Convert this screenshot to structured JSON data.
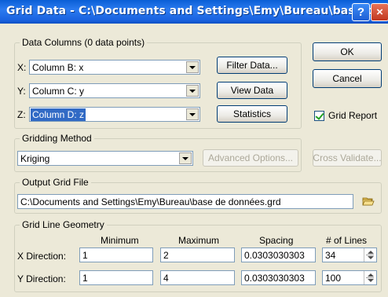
{
  "window": {
    "title": "Grid Data - C:\\Documents and Settings\\Emy\\Bureau\\base de...",
    "help_label": "?",
    "close_label": "×"
  },
  "data_columns": {
    "legend": "Data Columns   (0 data points)",
    "x": {
      "label": "X:",
      "value": "Column B:  x"
    },
    "y": {
      "label": "Y:",
      "value": "Column C:  y"
    },
    "z": {
      "label": "Z:",
      "value": "Column D:  z"
    }
  },
  "buttons": {
    "filter": "Filter Data...",
    "view": "View Data",
    "statistics": "Statistics",
    "ok": "OK",
    "cancel": "Cancel",
    "advanced": "Advanced Options...",
    "cross_validate": "Cross Validate..."
  },
  "grid_report": {
    "label": "Grid Report",
    "checked": true
  },
  "gridding_method": {
    "legend": "Gridding Method",
    "value": "Kriging"
  },
  "output_grid_file": {
    "legend": "Output Grid File",
    "path": "C:\\Documents and Settings\\Emy\\Bureau\\base de données.grd",
    "browse_icon": "open-folder-icon"
  },
  "geometry": {
    "legend": "Grid Line Geometry",
    "headers": {
      "minimum": "Minimum",
      "maximum": "Maximum",
      "spacing": "Spacing",
      "lines": "# of Lines"
    },
    "rows": [
      {
        "label": "X Direction:",
        "minimum": "1",
        "maximum": "2",
        "spacing": "0.0303030303",
        "lines": "34"
      },
      {
        "label": "Y Direction:",
        "minimum": "1",
        "maximum": "4",
        "spacing": "0.0303030303",
        "lines": "100"
      }
    ]
  }
}
